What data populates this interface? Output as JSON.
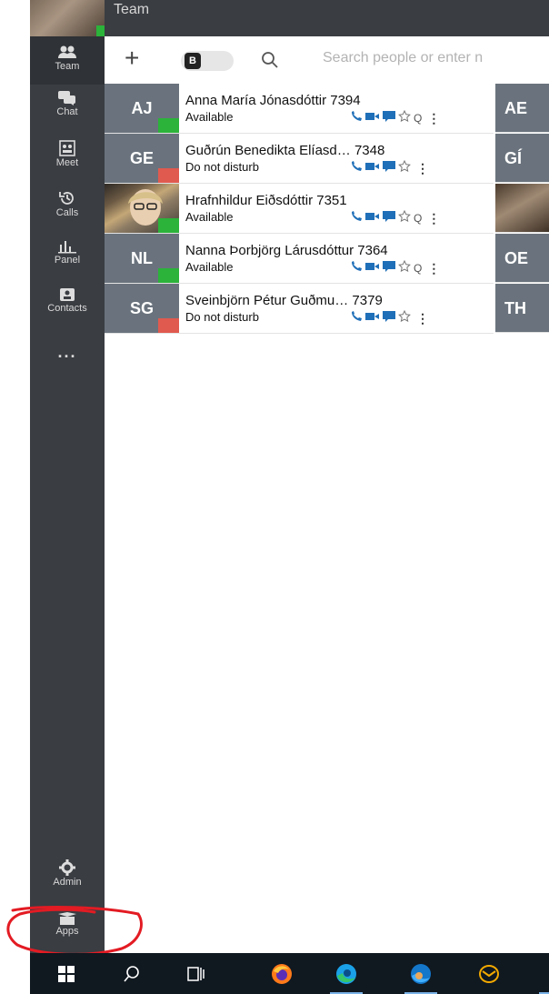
{
  "window": {
    "title": "Team"
  },
  "sidebar": {
    "items": [
      {
        "label": "Team",
        "icon": "people-icon"
      },
      {
        "label": "Chat",
        "icon": "chat-icon"
      },
      {
        "label": "Meet",
        "icon": "meet-icon"
      },
      {
        "label": "Calls",
        "icon": "history-icon"
      },
      {
        "label": "Panel",
        "icon": "chart-icon"
      },
      {
        "label": "Contacts",
        "icon": "contact-card-icon"
      }
    ],
    "more_label": "...",
    "bottom": [
      {
        "label": "Admin",
        "icon": "gear-icon"
      },
      {
        "label": "Apps",
        "icon": "apps-box-icon"
      }
    ]
  },
  "toolbar": {
    "add_label": "+",
    "toggle_label": "B",
    "search_placeholder": "Search people or enter n"
  },
  "contacts": [
    {
      "initials": "AJ",
      "name": "Anna María Jónasdóttir 7394",
      "status": "Available",
      "status_color": "#2bb33a"
    },
    {
      "initials": "GE",
      "name": "Guðrún Benedikta Elíasd… 7348",
      "status": "Do not disturb",
      "status_color": "#e05a4f"
    },
    {
      "initials": "",
      "name": "Hrafnhildur Eiðsdóttir 7351",
      "status": "Available",
      "status_color": "#2bb33a"
    },
    {
      "initials": "NL",
      "name": "Nanna Þorbjörg Lárusdóttur 7364",
      "status": "Available",
      "status_color": "#2bb33a"
    },
    {
      "initials": "SG",
      "name": "Sveinbjörn Pétur Guðmu… 7379",
      "status": "Do not disturb",
      "status_color": "#e05a4f"
    }
  ],
  "contacts_col2": [
    "AE",
    "GÍ",
    "",
    "OE",
    "TH"
  ],
  "taskbar": [
    "windows-icon",
    "search-icon",
    "task-view-icon",
    "firefox-icon",
    "edge-icon",
    "edge-beta-icon",
    "mail-icon"
  ]
}
